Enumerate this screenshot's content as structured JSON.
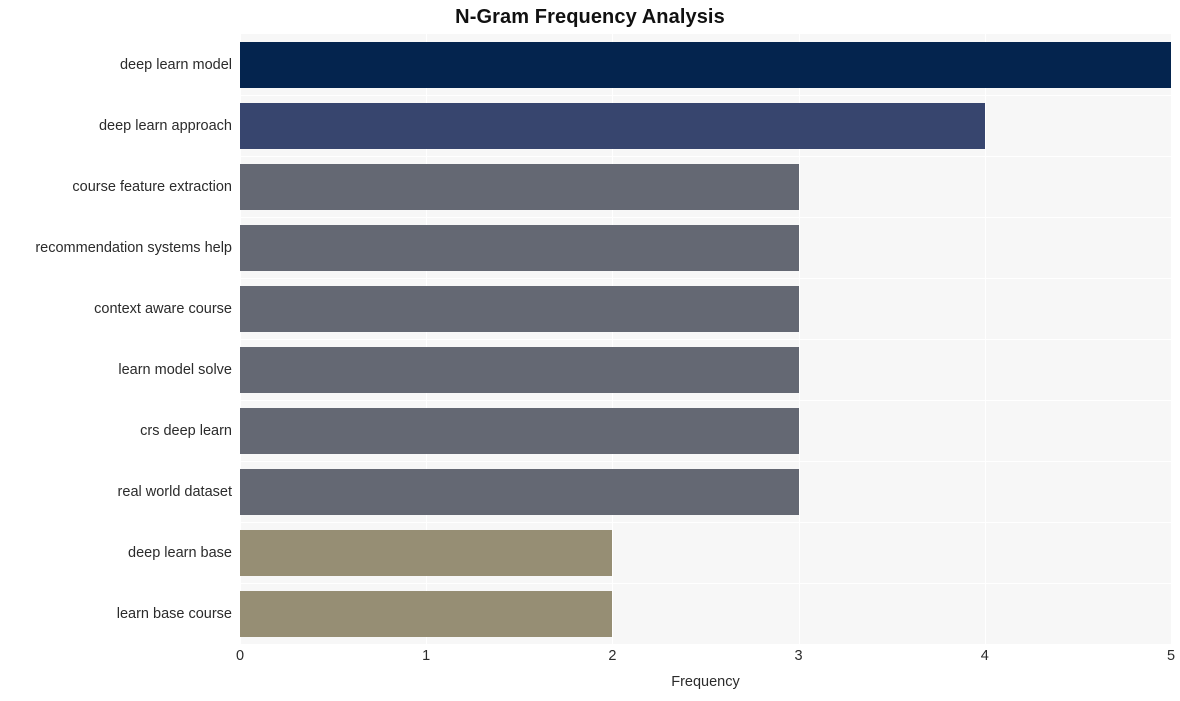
{
  "chart_data": {
    "type": "bar",
    "orientation": "horizontal",
    "title": "N-Gram Frequency Analysis",
    "xlabel": "Frequency",
    "ylabel": "",
    "categories": [
      "deep learn model",
      "deep learn approach",
      "course feature extraction",
      "recommendation systems help",
      "context aware course",
      "learn model solve",
      "crs deep learn",
      "real world dataset",
      "deep learn base",
      "learn base course"
    ],
    "values": [
      5,
      4,
      3,
      3,
      3,
      3,
      3,
      3,
      2,
      2
    ],
    "bar_colors": [
      "#04244e",
      "#37456e",
      "#646873",
      "#646873",
      "#646873",
      "#646873",
      "#646873",
      "#646873",
      "#968e74",
      "#968e74"
    ],
    "xlim": [
      0,
      5
    ],
    "xticks": [
      0,
      1,
      2,
      3,
      4,
      5
    ],
    "xtick_labels": [
      "0",
      "1",
      "2",
      "3",
      "4",
      "5"
    ],
    "grid": true,
    "grid_color": "#ffffff",
    "plot_background": "#f7f7f7",
    "figure_background": "#ffffff",
    "legend": null,
    "title_color": "#111111",
    "tick_label_color": "#2b2b2b"
  }
}
